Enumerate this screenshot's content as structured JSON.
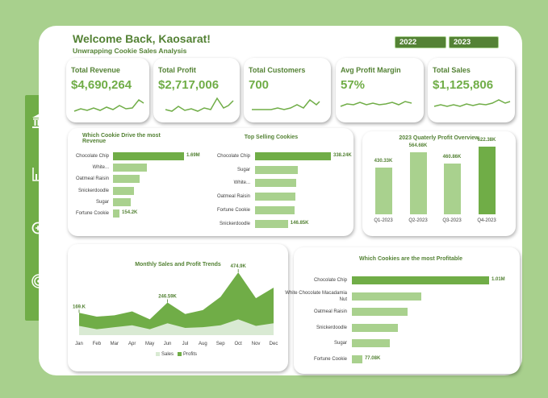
{
  "header": {
    "title": "Welcome Back, Kaosarat!",
    "subtitle": "Unwrapping Cookie Sales Analysis",
    "years": [
      "2022",
      "2023"
    ]
  },
  "sidebar": {
    "items": [
      {
        "icon": "bank-icon"
      },
      {
        "icon": "bar-chart-icon"
      },
      {
        "icon": "zoom-search-icon"
      },
      {
        "icon": "target-icon"
      }
    ]
  },
  "kpis": [
    {
      "label": "Total Revenue",
      "value": "$4,690,264"
    },
    {
      "label": "Total Profit",
      "value": "$2,717,006"
    },
    {
      "label": "Total Customers",
      "value": "700"
    },
    {
      "label": "Avg Profit Margin",
      "value": "57%"
    },
    {
      "label": "Total Sales",
      "value": "$1,125,806"
    }
  ],
  "colors": {
    "accent": "#70ad47",
    "dark": "#548235",
    "light": "#a9d18e",
    "background": "#a8d08d"
  },
  "chart_data": [
    {
      "type": "bar",
      "orientation": "horizontal",
      "title": "Which Cookie Drive the most Revenue",
      "categories": [
        "Chocolate Chip",
        "White...",
        "Oatmeal Raisin",
        "Snickerdoodle",
        "Sugar",
        "Fortune Cookie"
      ],
      "values": [
        1690000,
        800000,
        640000,
        490000,
        420000,
        154200
      ],
      "labels": [
        "1.69M",
        "",
        "",
        "",
        "",
        "154.2K"
      ]
    },
    {
      "type": "bar",
      "orientation": "horizontal",
      "title": "Top Selling Cookies",
      "categories": [
        "Chocolate Chip",
        "Sugar",
        "White...",
        "Oatmeal Raisin",
        "Fortune Cookie",
        "Snickerdoodle"
      ],
      "values": [
        338240,
        190000,
        185000,
        180000,
        178000,
        146850
      ],
      "labels": [
        "338.24K",
        "",
        "",
        "",
        "",
        "146.85K"
      ]
    },
    {
      "type": "bar",
      "title": "2023 Quaterly Profit Overview",
      "categories": [
        "Q1-2023",
        "Q2-2023",
        "Q3-2023",
        "Q4-2023"
      ],
      "values": [
        430330,
        564680,
        460860,
        622380
      ],
      "labels": [
        "430.33K",
        "564.68K",
        "460.86K",
        "622.38K"
      ],
      "ylim": [
        0,
        700000
      ]
    },
    {
      "type": "area",
      "title": "Monthly Sales and Profit Trends",
      "categories": [
        "Jan",
        "Feb",
        "Mar",
        "Apr",
        "May",
        "Jun",
        "Jul",
        "Aug",
        "Sep",
        "Oct",
        "Nov",
        "Dec"
      ],
      "series": [
        {
          "name": "Sales",
          "values": [
            70000,
            45000,
            60000,
            75000,
            45000,
            90000,
            55000,
            60000,
            75000,
            120000,
            70000,
            90000
          ]
        },
        {
          "name": "Profits",
          "values": [
            169000,
            140000,
            150000,
            180000,
            120000,
            246590,
            160000,
            190000,
            290000,
            474900,
            280000,
            360000
          ]
        }
      ],
      "annotations": [
        "169.K",
        "246.59K",
        "474.9K"
      ],
      "ylim": [
        0,
        500000
      ]
    },
    {
      "type": "bar",
      "orientation": "horizontal",
      "title": "Which Cookies are the most Profitable",
      "categories": [
        "Chocolate Chip",
        "White Chocolate Macadamia Nut",
        "Oatmeal Raisin",
        "Snickerdoodle",
        "Sugar",
        "Fortune Cookie"
      ],
      "values": [
        1010000,
        510000,
        410000,
        340000,
        280000,
        77080
      ],
      "labels": [
        "1.01M",
        "",
        "",
        "",
        "",
        "77.08K"
      ]
    }
  ]
}
